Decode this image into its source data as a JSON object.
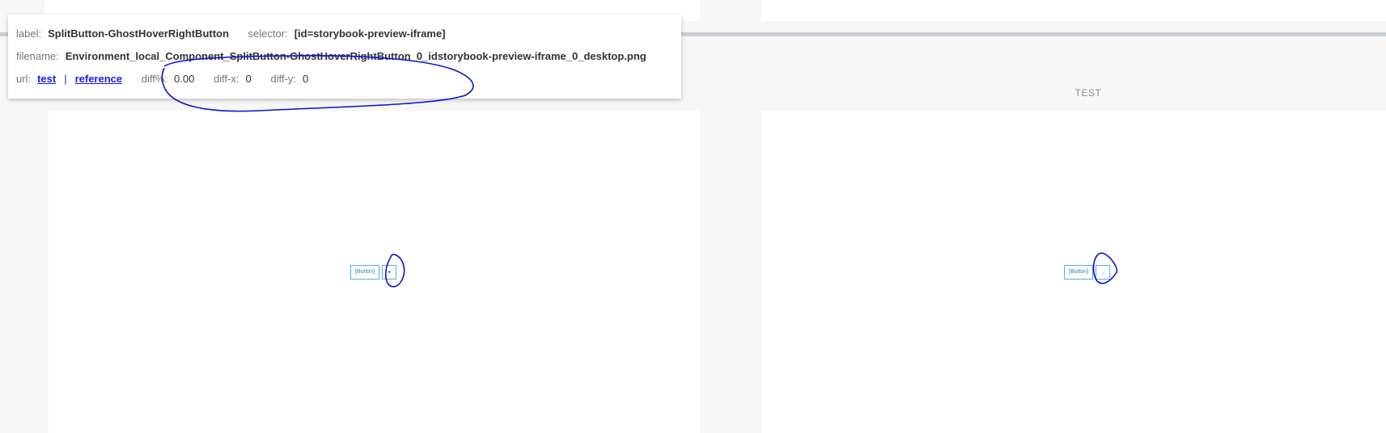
{
  "info": {
    "label_key": "label:",
    "label_value": "SplitButton-GhostHoverRightButton",
    "selector_key": "selector:",
    "selector_value": "[id=storybook-preview-iframe]",
    "filename_key": "filename:",
    "filename_value": "Environment_local_Component_SplitButton-GhostHoverRightButton_0_idstorybook-preview-iframe_0_desktop.png",
    "url_key": "url:",
    "test_link": "test",
    "separator": "|",
    "reference_link": "reference",
    "diff_percent_key": "diff%:",
    "diff_percent_value": "0.00",
    "diff_x_key": "diff-x:",
    "diff_x_value": "0",
    "diff_y_key": "diff-y:",
    "diff_y_value": "0"
  },
  "right_header": "TEST",
  "left_preview": {
    "button_label": "[Button]",
    "arrow_glyph": "▾"
  },
  "right_preview": {
    "button_label": "[Button]",
    "arrow_glyph": "⌄"
  },
  "colors": {
    "annotation": "#0a12d6",
    "link": "#1a1aee",
    "button_border": "#5aaedb"
  }
}
